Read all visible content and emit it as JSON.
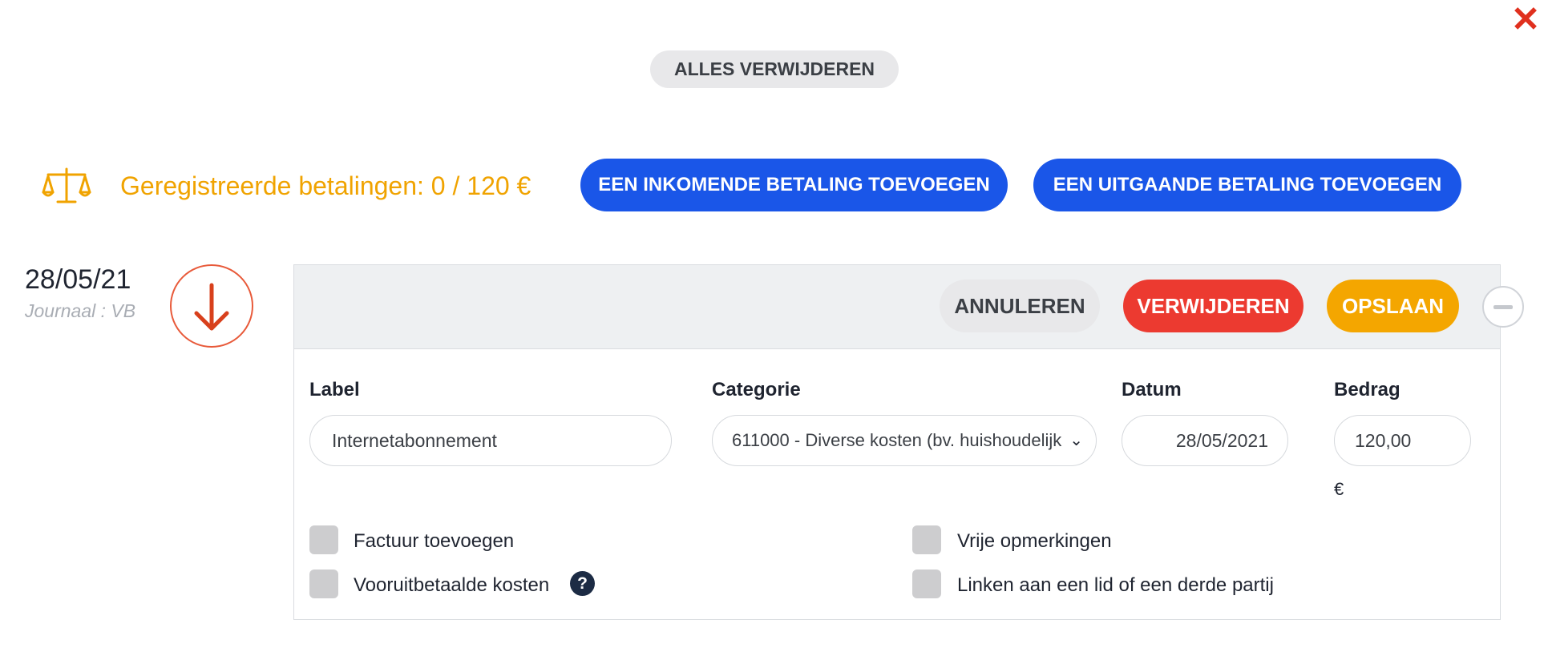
{
  "header": {
    "close_icon": "close-icon",
    "delete_all_label": "ALLES VERWIJDEREN"
  },
  "summary": {
    "icon": "balance-scale-icon",
    "registered_text": "Geregistreerde betalingen: 0 / 120 €",
    "add_incoming_label": "EEN INKOMENDE BETALING TOEVOEGEN",
    "add_outgoing_label": "EEN UITGAANDE BETALING TOEVOEGEN",
    "accent_color": "#f0a300",
    "button_color": "#1a56e8"
  },
  "payment": {
    "date": "28/05/21",
    "journal": "Journaal : VB",
    "direction_icon": "arrow-down-icon",
    "actions": {
      "cancel_label": "ANNULEREN",
      "delete_label": "VERWIJDEREN",
      "save_label": "OPSLAAN",
      "collapse_icon": "minus-circle-icon"
    },
    "fields": {
      "label_title": "Label",
      "label_value": "Internetabonnement",
      "category_title": "Categorie",
      "category_value": "611000 - Diverse kosten (bv. huishoudelijk",
      "date_title": "Datum",
      "date_value": "28/05/2021",
      "amount_title": "Bedrag",
      "amount_value": "120,00",
      "currency": "€"
    },
    "options": {
      "invoice": "Factuur toevoegen",
      "prepaid": "Vooruitbetaalde kosten",
      "help_icon": "question-circle-icon",
      "notes": "Vrije opmerkingen",
      "link_member": "Linken aan een lid of een derde partij"
    }
  }
}
